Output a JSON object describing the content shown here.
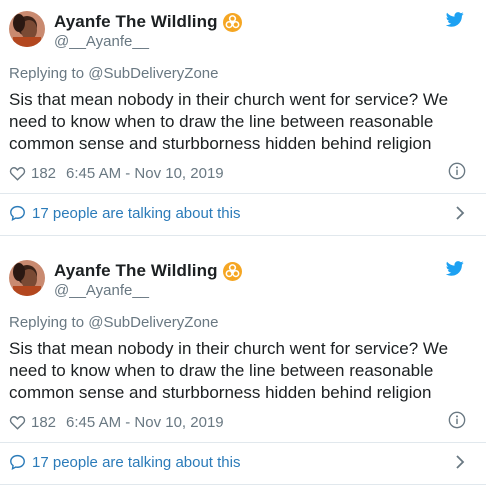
{
  "colors": {
    "link": "#2b7bb9",
    "muted": "#697882",
    "text": "#1c2022",
    "twitter_blue": "#1da1f2",
    "badge_orange": "#f5a623"
  },
  "tweets": [
    {
      "author_name": "Ayanfe The Wildling",
      "badge_icon": "biohazard-icon",
      "handle": "@__Ayanfe__",
      "reply_context": "Replying to @SubDeliveryZone",
      "text": "Sis that mean nobody in their church went for service? We need to know when to draw the line between reasonable common sense and sturbborness hidden behind religion",
      "likes": "182",
      "timestamp": "6:45 AM - Nov 10, 2019",
      "talking": "17 people are talking about this"
    },
    {
      "author_name": "Ayanfe The Wildling",
      "badge_icon": "biohazard-icon",
      "handle": "@__Ayanfe__",
      "reply_context": "Replying to @SubDeliveryZone",
      "text": "Sis that mean nobody in their church went for service? We need to know when to draw the line between reasonable common sense and sturbborness hidden behind religion",
      "likes": "182",
      "timestamp": "6:45 AM - Nov 10, 2019",
      "talking": "17 people are talking about this"
    }
  ]
}
